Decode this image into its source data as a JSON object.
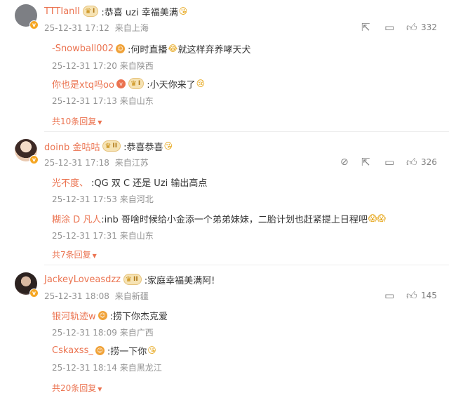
{
  "threads": [
    {
      "user": "TTTIanII",
      "level": "I",
      "text": ":恭喜 uzi 幸福美满",
      "emoji": "😘",
      "date": "25-12-31 17:12",
      "location": "来自上海",
      "likes": "332",
      "replies": [
        {
          "user": "-Snowball002",
          "text": ":何时直播",
          "emoji": "😂",
          "text2": "就这样弃养哮天犬",
          "date": "25-12-31 17:20",
          "location": "来自陕西"
        },
        {
          "user": "你也是xtq吗oo",
          "level": "I",
          "text": ":小天你来了",
          "emoji": "😢",
          "text2": "",
          "date": "25-12-31 17:13",
          "location": "来自山东"
        }
      ],
      "more": "共10条回复"
    },
    {
      "user": "doinb 金咕咕",
      "level": "II",
      "text": ":恭喜恭喜",
      "emoji": "😘",
      "date": "25-12-31 17:18",
      "location": "来自江苏",
      "likes": "326",
      "replies": [
        {
          "user": "光不度、",
          "text": ":QG 双 C 还是 Uzi 输出高点",
          "emoji": "",
          "text2": "",
          "date": "25-12-31 17:53",
          "location": "来自河北"
        },
        {
          "user": "糊涂 D 凡人",
          "text": ":inb 哥啥时候给小金添一个弟弟妹妹，二胎计划也赶紧提上日程吧",
          "emoji": "😱😱",
          "text2": "",
          "date": "25-12-31 17:31",
          "location": "来自山东"
        }
      ],
      "more": "共7条回复"
    },
    {
      "user": "JackeyLoveasdzz",
      "level": "II",
      "text": ":家庭幸福美满阿!",
      "emoji": "",
      "date": "25-12-31 18:08",
      "location": "来自新疆",
      "likes": "145",
      "replies": [
        {
          "user": "银河轨迹w",
          "text": ":捞下你杰克爱",
          "emoji": "",
          "text2": "",
          "date": "25-12-31 18:09",
          "location": "来自广西"
        },
        {
          "user": "Cskaxss_",
          "text": ":捞一下你",
          "emoji": "😘",
          "text2": "",
          "date": "25-12-31 18:14",
          "location": "来自黑龙江"
        }
      ],
      "more": "共20条回复"
    }
  ],
  "icons": {
    "share": "share-icon",
    "comment": "comment-icon",
    "like": "thumb-up-icon",
    "report": "report-icon",
    "expand": "chevron-down-icon"
  },
  "colors": {
    "username": "#eb7350",
    "meta": "#939393",
    "level_badge_bg": "#f6e3b4"
  }
}
